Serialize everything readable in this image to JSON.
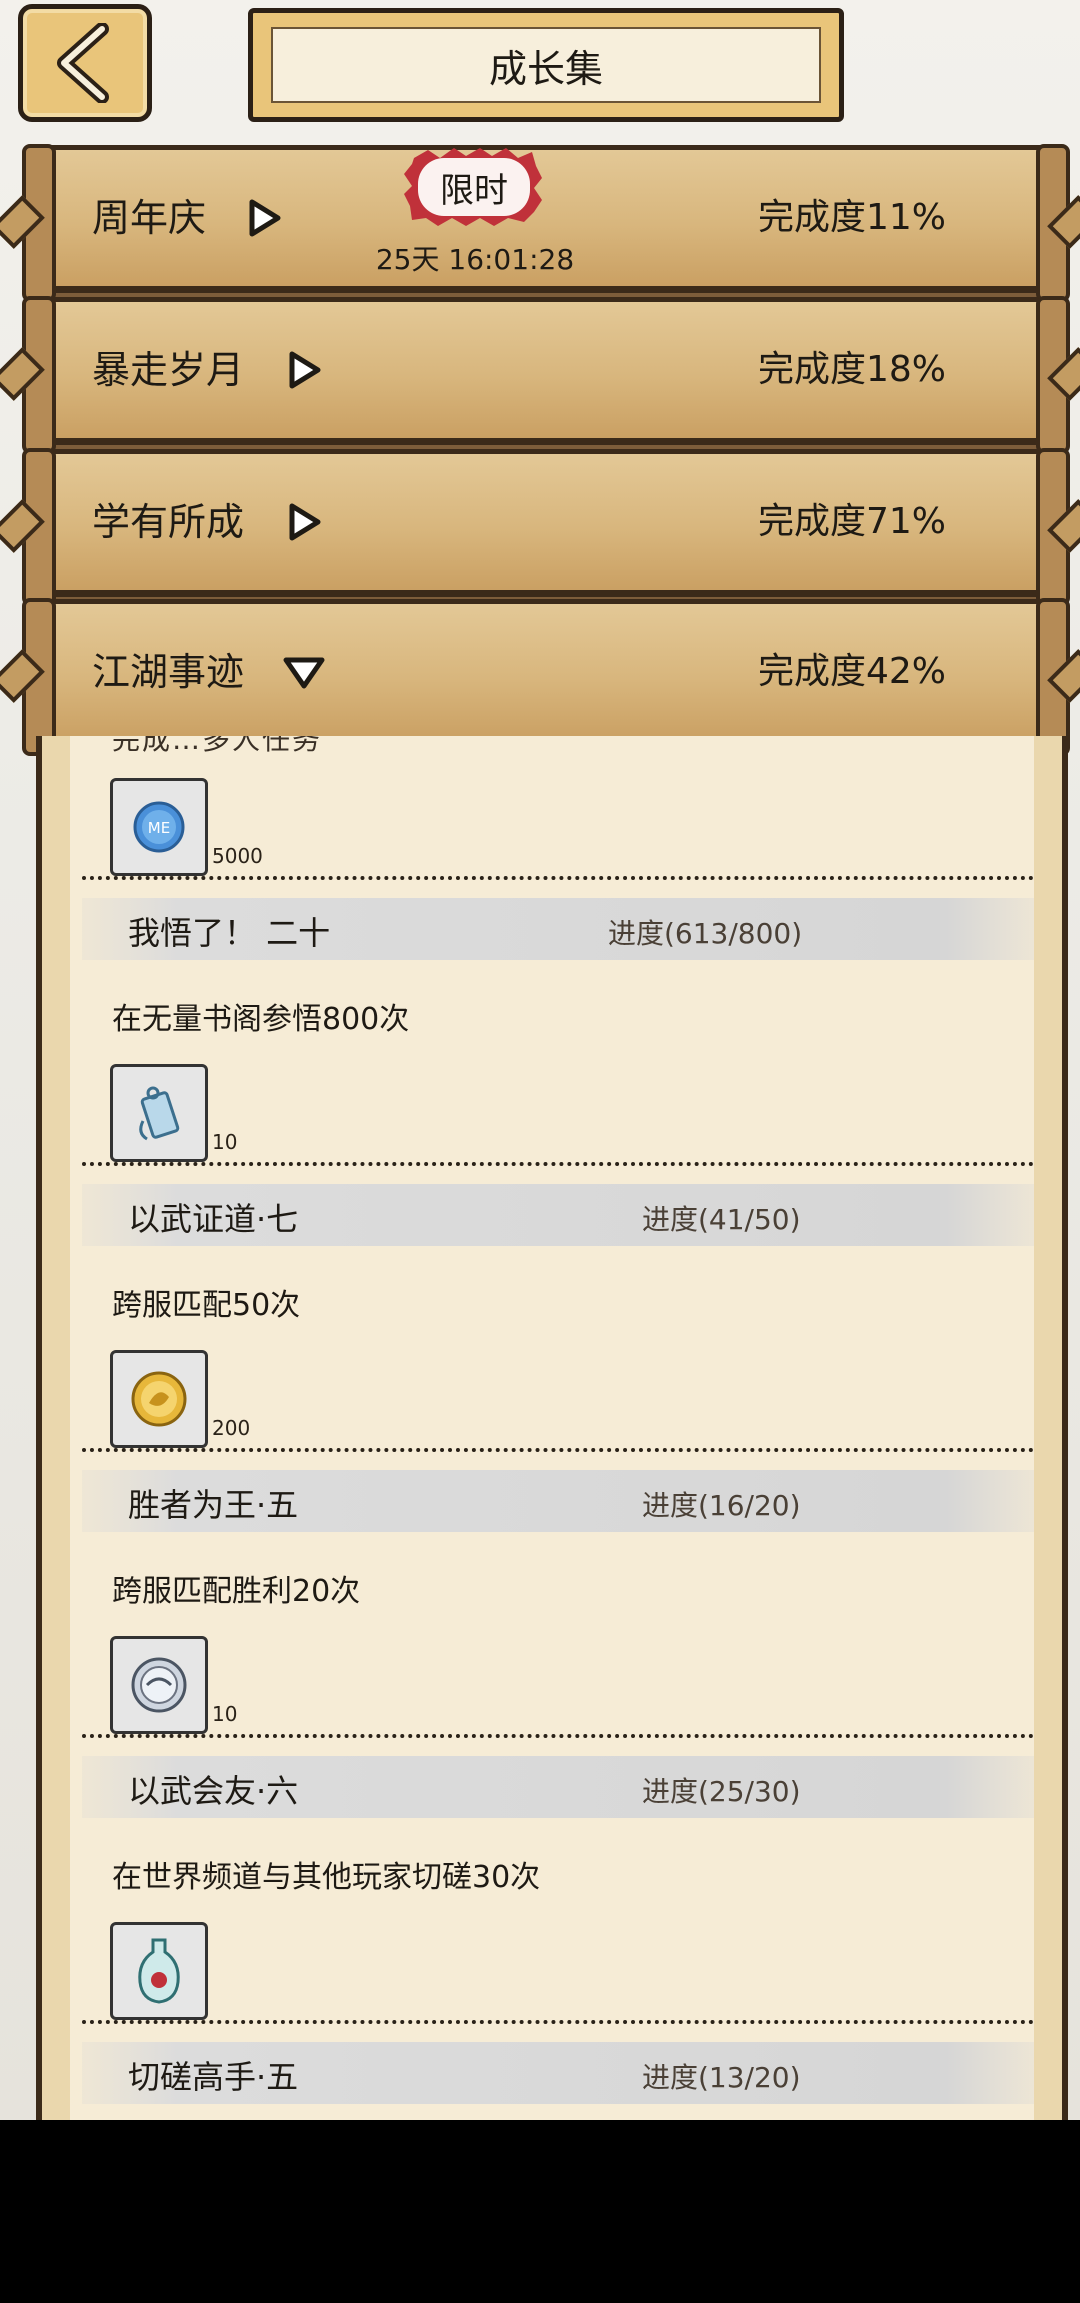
{
  "header": {
    "back_label": "back",
    "title": "成长集"
  },
  "categories": [
    {
      "name": "周年庆",
      "progress": "完成度11%",
      "expanded": false
    },
    {
      "name": "暴走岁月",
      "progress": "完成度18%",
      "expanded": false
    },
    {
      "name": "学有所成",
      "progress": "完成度71%",
      "expanded": false
    },
    {
      "name": "江湖事迹",
      "progress": "完成度42%",
      "expanded": true
    }
  ],
  "limited": {
    "badge": "限时",
    "countdown": "25天 16:01:28"
  },
  "partial_top": {
    "text": "完成…多人任务",
    "reward_count": "5000",
    "reward_icon": "me-coin-icon"
  },
  "achievements": [
    {
      "name": "我悟了！ 二十",
      "progress": "进度(613/800)",
      "desc": "在无量书阁参悟800次",
      "reward_count": "10",
      "reward_icon": "badge-tag-icon"
    },
    {
      "name": "以武证道·七",
      "progress": "进度(41/50)",
      "desc": "跨服匹配50次",
      "reward_count": "200",
      "reward_icon": "gold-coin-icon"
    },
    {
      "name": "胜者为王·五",
      "progress": "进度(16/20)",
      "desc": "跨服匹配胜利20次",
      "reward_count": "10",
      "reward_icon": "silver-coin-icon"
    },
    {
      "name": "以武会友·六",
      "progress": "进度(25/30)",
      "desc": "在世界频道与其他玩家切磋30次",
      "reward_count": "",
      "reward_icon": "vase-icon"
    },
    {
      "name": "切磋高手·五",
      "progress": "进度(13/20)"
    }
  ],
  "colors": {
    "parchment": "#f6ecd6",
    "bar": "#d8b67d",
    "outline": "#3b2a19",
    "badge_border": "#c0313a"
  }
}
